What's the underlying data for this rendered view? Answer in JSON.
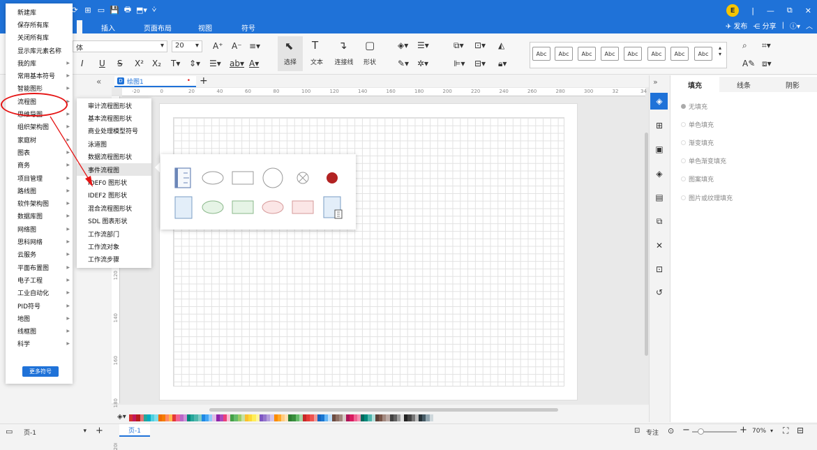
{
  "quick_access": [
    "⟳",
    "⊞",
    "▭",
    "💾",
    "🖶",
    "⬒▾",
    "⩒"
  ],
  "menu_tabs": [
    {
      "label": "",
      "w": 0
    },
    {
      "label": "插入"
    },
    {
      "label": "页面布局"
    },
    {
      "label": "视图"
    },
    {
      "label": "符号"
    }
  ],
  "user": {
    "avatar_letter": "E",
    "publish": "发布",
    "share": "分享",
    "help": "?"
  },
  "ribbon": {
    "font_name": "体",
    "font_size": "20",
    "select_label": "选择",
    "text_label": "文本",
    "connector_label": "连接线",
    "shape_label": "形状",
    "style_swatch_text": "Abc"
  },
  "doc_tab": {
    "name": "绘图1",
    "dot": "•",
    "add": "+",
    "collapse": "«"
  },
  "ruler_h": [
    "-20",
    "0",
    "20",
    "40",
    "60",
    "80",
    "100",
    "120",
    "140",
    "160",
    "180",
    "200",
    "220",
    "240",
    "260",
    "280",
    "300",
    "32",
    "34"
  ],
  "ruler_v": [
    "120",
    "140",
    "160",
    "180",
    "200"
  ],
  "library_menu": {
    "items": [
      {
        "label": "新建库",
        "arrow": false
      },
      {
        "label": "保存所有库",
        "arrow": false
      },
      {
        "label": "关闭所有库",
        "arrow": false
      },
      {
        "label": "显示库元素名称",
        "arrow": false
      },
      {
        "label": "我的库",
        "arrow": true
      },
      {
        "label": "常用基本符号",
        "arrow": true
      },
      {
        "label": "智能图形",
        "arrow": true
      },
      {
        "label": "流程图",
        "arrow": true
      },
      {
        "label": "思维导图",
        "arrow": true
      },
      {
        "label": "组织架构图",
        "arrow": true
      },
      {
        "label": "家庭树",
        "arrow": true
      },
      {
        "label": "图表",
        "arrow": true
      },
      {
        "label": "商务",
        "arrow": true
      },
      {
        "label": "项目管理",
        "arrow": true
      },
      {
        "label": "路线图",
        "arrow": true
      },
      {
        "label": "软件架构图",
        "arrow": true
      },
      {
        "label": "数据库图",
        "arrow": true
      },
      {
        "label": "网络图",
        "arrow": true
      },
      {
        "label": "思科网络",
        "arrow": true
      },
      {
        "label": "云服务",
        "arrow": true
      },
      {
        "label": "平面布置图",
        "arrow": true
      },
      {
        "label": "电子工程",
        "arrow": true
      },
      {
        "label": "工业自动化",
        "arrow": true
      },
      {
        "label": "PID符号",
        "arrow": true
      },
      {
        "label": "地图",
        "arrow": true
      },
      {
        "label": "线框图",
        "arrow": true
      },
      {
        "label": "科学",
        "arrow": true
      }
    ],
    "more_button": "更多符号",
    "arrow_glyph": "▶"
  },
  "flowchart_submenu": {
    "items": [
      "审计流程图形状",
      "基本流程图形状",
      "商业处理模型符号",
      "泳道图",
      "数据流程图形状",
      "事件流程图",
      "IDEF0 图形状",
      "IDEF2 图形状",
      "混合流程图形状",
      "SDL 图表形状",
      "工作流部门",
      "工作流对象",
      "工作流步骤"
    ],
    "highlighted": "事件流程图"
  },
  "right_panel": {
    "tabs": [
      "填充",
      "线条",
      "阴影"
    ],
    "active_tab": "填充",
    "fill_options": [
      "无填充",
      "单色填充",
      "渐变填充",
      "单色渐变填充",
      "图案填充",
      "图片或纹理填充"
    ],
    "selected_fill": "无填充"
  },
  "right_toolbar_icons": [
    "fill-bucket-icon",
    "grid-icon",
    "image-icon",
    "layers-icon",
    "page-icon",
    "shapes-icon",
    "shuffle-icon",
    "present-icon",
    "history-icon"
  ],
  "status": {
    "page_select": "页-1",
    "add": "+",
    "page_tab": "页-1",
    "focus": "专注",
    "zoom": "70%",
    "zoom_minus": "−",
    "zoom_plus": "+"
  },
  "colors": {
    "titlebar": "#1f72d8",
    "annotation": "#e51515",
    "event_red": "#b22222"
  },
  "palette": [
    "#d32f2f",
    "#c2185b",
    "#b71c1c",
    "#e57373",
    "#26a69a",
    "#00acc1",
    "#4dd0e1",
    "#80deea",
    "#ef6c00",
    "#f57c00",
    "#ff8a65",
    "#ffb74d",
    "#e53935",
    "#f06292",
    "#ba68c8",
    "#ce93d8",
    "#00897b",
    "#26a69a",
    "#4db6ac",
    "#80cbc4",
    "#1e88e5",
    "#42a5f5",
    "#90caf9",
    "#e1bee7",
    "#8e24aa",
    "#ab47bc",
    "#ec407a",
    "#f8bbd0",
    "#43a047",
    "#66bb6a",
    "#9ccc65",
    "#c5e1a5",
    "#fbc02d",
    "#fdd835",
    "#ffee58",
    "#fff59d",
    "#7e57c2",
    "#9575cd",
    "#b39ddb",
    "#d1c4e9",
    "#fb8c00",
    "#ffa726",
    "#ffcc80",
    "#ffe0b2",
    "#2e7d32",
    "#388e3c",
    "#66bb6a",
    "#a5d6a7",
    "#c62828",
    "#e53935",
    "#ef5350",
    "#ef9a9a",
    "#1565c0",
    "#1976d2",
    "#64b5f6",
    "#bbdefb",
    "#6d4c41",
    "#8d6e63",
    "#a1887f",
    "#d7ccc8",
    "#ad1457",
    "#d81b60",
    "#f06292",
    "#f48fb1",
    "#00695c",
    "#00897b",
    "#4db6ac",
    "#b2dfdb",
    "#5d4037",
    "#795548",
    "#a1887f",
    "#bcaaa4",
    "#424242",
    "#616161",
    "#9e9e9e",
    "#e0e0e0",
    "#212121",
    "#424242",
    "#757575",
    "#bdbdbd",
    "#263238",
    "#455a64",
    "#90a4ae",
    "#cfd8dc"
  ]
}
